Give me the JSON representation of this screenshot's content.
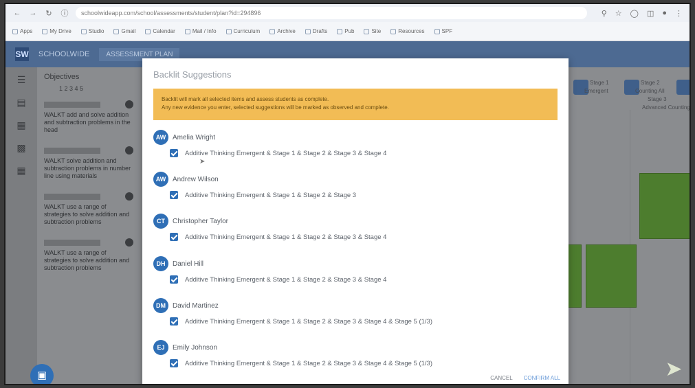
{
  "browser": {
    "url": "schoolwideapp.com/school/assessments/student/plan?id=294896",
    "nav_icons": [
      "arrow-left",
      "arrow-right",
      "refresh",
      "site-info"
    ],
    "right_icons": [
      "zoom",
      "star",
      "extensions",
      "sidebar",
      "profile",
      "menu"
    ],
    "bookmarks": [
      "Apps",
      "My Drive",
      "Studio",
      "Gmail",
      "Calendar",
      "Mail / Info",
      "Curriculum",
      "Archive",
      "Drafts",
      "Pub",
      "Site",
      "Resources",
      "SPF"
    ]
  },
  "app": {
    "logo_text": "SW",
    "name": "SCHOOLWIDE",
    "tab": "ASSESSMENT PLAN"
  },
  "left_rail": {
    "icons": [
      "menu-icon",
      "book-icon",
      "calendar-icon",
      "clipboard-icon",
      "grid-icon"
    ]
  },
  "objectives": {
    "title": "Objectives",
    "subtitle": "1 2 3 4 5",
    "items": [
      {
        "text": "WALKT add and solve addition and subtraction problems in the head"
      },
      {
        "text": "WALKT solve addition and subtraction problems in number line using materials"
      },
      {
        "text": "WALKT use a range of strategies to solve addition and subtraction problems"
      },
      {
        "text": "WALKT use a range of strategies to solve addition and subtraction problems"
      }
    ]
  },
  "grid": {
    "chips": [
      {
        "label": "Stage 1",
        "sub": "Emergent"
      },
      {
        "label": "Stage 2",
        "sub": "Counting All"
      },
      {
        "label": "Stage 3",
        "sub": "Advanced Counting"
      }
    ]
  },
  "modal": {
    "title": "Backlit Suggestions",
    "alert_line1": "Backlit will mark all selected items and assess students as complete.",
    "alert_line2": "Any new evidence you enter, selected suggestions will be marked as observed and complete.",
    "students": [
      {
        "initials": "AW",
        "name": "Amelia Wright",
        "suggestion": "Additive Thinking Emergent & Stage 1 & Stage 2 & Stage 3 & Stage 4"
      },
      {
        "initials": "AW",
        "name": "Andrew Wilson",
        "suggestion": "Additive Thinking Emergent & Stage 1 & Stage 2 & Stage 3"
      },
      {
        "initials": "CT",
        "name": "Christopher Taylor",
        "suggestion": "Additive Thinking Emergent & Stage 1 & Stage 2 & Stage 3 & Stage 4"
      },
      {
        "initials": "DH",
        "name": "Daniel Hill",
        "suggestion": "Additive Thinking Emergent & Stage 1 & Stage 2 & Stage 3 & Stage 4"
      },
      {
        "initials": "DM",
        "name": "David Martinez",
        "suggestion": "Additive Thinking Emergent & Stage 1 & Stage 2 & Stage 3 & Stage 4 & Stage 5 (1/3)"
      },
      {
        "initials": "EJ",
        "name": "Emily Johnson",
        "suggestion": "Additive Thinking Emergent & Stage 1 & Stage 2 & Stage 3 & Stage 4 & Stage 5 (1/3)"
      }
    ],
    "cancel_label": "CANCEL",
    "confirm_label": "CONFIRM ALL"
  },
  "colors": {
    "app_bar": "#4d6a92",
    "accent_blue": "#2f6fb6",
    "alert_yellow": "#f2bc55",
    "green_cell": "#4d7d2e"
  }
}
